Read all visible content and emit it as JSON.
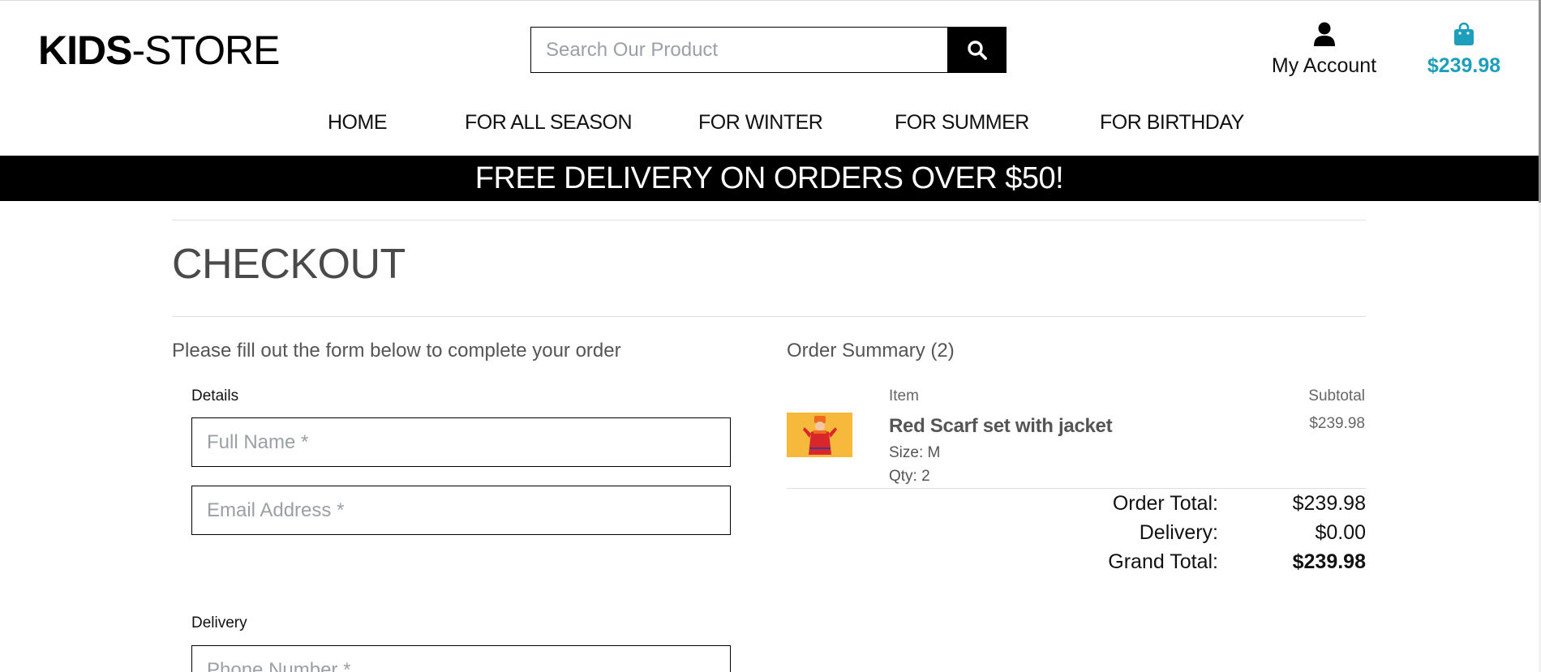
{
  "header": {
    "logo_bold": "KIDS",
    "logo_rest": "-STORE",
    "search_placeholder": "Search Our Product",
    "account_label": "My Account",
    "bag_total": "$239.98"
  },
  "nav": {
    "items": [
      {
        "label": "HOME"
      },
      {
        "label": "FOR ALL SEASON"
      },
      {
        "label": "FOR WINTER"
      },
      {
        "label": "FOR SUMMER"
      },
      {
        "label": "FOR BIRTHDAY"
      }
    ]
  },
  "banner": {
    "text": "FREE DELIVERY ON ORDERS OVER $50!"
  },
  "checkout": {
    "title": "CHECKOUT",
    "intro": "Please fill out the form below to complete your order",
    "details_label": "Details",
    "full_name_placeholder": "Full Name *",
    "email_placeholder": "Email Address *",
    "delivery_label": "Delivery",
    "phone_placeholder": "Phone Number *"
  },
  "summary": {
    "title": "Order Summary (2)",
    "item_header": "Item",
    "subtotal_header": "Subtotal",
    "product": {
      "name": "Red Scarf set with jacket",
      "size": "Size: M",
      "qty": "Qty: 2",
      "subtotal": "$239.98"
    },
    "order_total_label": "Order Total:",
    "order_total_value": "$239.98",
    "delivery_label": "Delivery:",
    "delivery_value": "$0.00",
    "grand_total_label": "Grand Total:",
    "grand_total_value": "$239.98"
  },
  "colors": {
    "accent": "#1d9fbb",
    "banner_bg": "#000000",
    "text_muted": "#555555"
  },
  "icons": {
    "search": "search-icon",
    "account": "user-icon",
    "bag": "shopping-bag-icon"
  }
}
